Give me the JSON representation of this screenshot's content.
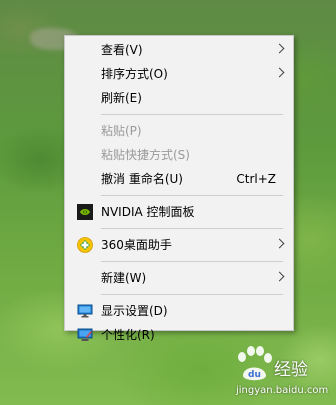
{
  "menu": {
    "items": [
      {
        "label": "查看(V)",
        "has_submenu": true,
        "enabled": true
      },
      {
        "label": "排序方式(O)",
        "has_submenu": true,
        "enabled": true
      },
      {
        "label": "刷新(E)",
        "has_submenu": false,
        "enabled": true
      },
      {
        "label": "粘贴(P)",
        "has_submenu": false,
        "enabled": false
      },
      {
        "label": "粘贴快捷方式(S)",
        "has_submenu": false,
        "enabled": false
      },
      {
        "label": "撤消 重命名(U)",
        "shortcut": "Ctrl+Z",
        "enabled": true
      },
      {
        "label": "NVIDIA 控制面板",
        "icon": "nvidia-icon",
        "enabled": true
      },
      {
        "label": "360桌面助手",
        "icon": "360-desktop-icon",
        "has_submenu": true,
        "enabled": true
      },
      {
        "label": "新建(W)",
        "has_submenu": true,
        "enabled": true
      },
      {
        "label": "显示设置(D)",
        "icon": "display-settings-icon",
        "enabled": true
      },
      {
        "label": "个性化(R)",
        "icon": "personalize-icon",
        "enabled": true
      }
    ]
  },
  "watermark": {
    "text": "经验",
    "url": "jingyan.baidu.com"
  },
  "colors": {
    "menu_bg": "#f2f2f2",
    "menu_border": "#c8c8c8",
    "disabled_text": "#9a9a9a",
    "nvidia_green": "#76b900"
  }
}
